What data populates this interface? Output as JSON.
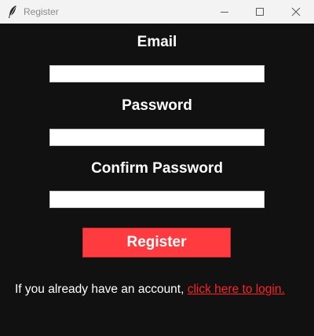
{
  "window": {
    "title": "Register",
    "icon": "feather-icon"
  },
  "form": {
    "email_label": "Email",
    "email_value": "",
    "password_label": "Password",
    "password_value": "",
    "confirm_label": "Confirm Password",
    "confirm_value": "",
    "register_label": "Register"
  },
  "login": {
    "prompt": "If you already have an account, ",
    "link_text": "click here to login."
  },
  "colors": {
    "background": "#111111",
    "accent": "#ff3b3f",
    "link": "#ff2222",
    "titlebar": "#f3f3f3"
  }
}
